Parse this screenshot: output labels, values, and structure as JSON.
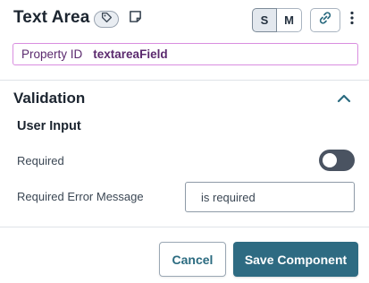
{
  "header": {
    "title": "Text Area",
    "tag_icon": "tag-icon",
    "note_icon": "note-icon",
    "size_options": [
      "S",
      "M"
    ],
    "selected_size": "S",
    "link_icon": "link-icon",
    "more_icon": "more-vertical-icon"
  },
  "property": {
    "label": "Property ID",
    "value": "textareaField"
  },
  "validation": {
    "title": "Validation",
    "collapse_icon": "chevron-up-icon",
    "group_title": "User Input",
    "required_label": "Required",
    "required_enabled": false,
    "error_message_label": "Required Error Message",
    "error_message_value": "is required"
  },
  "footer": {
    "cancel_label": "Cancel",
    "save_label": "Save Component"
  },
  "colors": {
    "accent": "#2e6b82",
    "property_border": "#d98ee0",
    "property_text": "#5b2a6e",
    "toggle_off": "#4a5361"
  }
}
